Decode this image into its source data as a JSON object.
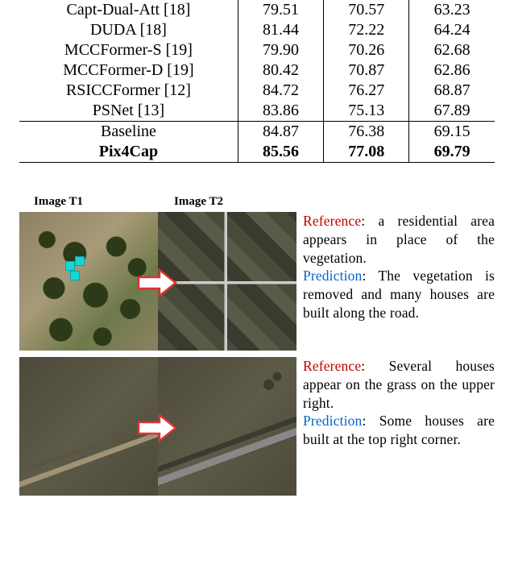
{
  "table": {
    "rows_top": [
      {
        "method": "Capt-Dual-Att [18]",
        "c1": "79.51",
        "c2": "70.57",
        "c3": "63.23"
      },
      {
        "method": "DUDA [18]",
        "c1": "81.44",
        "c2": "72.22",
        "c3": "64.24"
      },
      {
        "method": "MCCFormer-S [19]",
        "c1": "79.90",
        "c2": "70.26",
        "c3": "62.68"
      },
      {
        "method": "MCCFormer-D [19]",
        "c1": "80.42",
        "c2": "70.87",
        "c3": "62.86"
      },
      {
        "method": "RSICCFormer [12]",
        "c1": "84.72",
        "c2": "76.27",
        "c3": "68.87"
      },
      {
        "method": "PSNet [13]",
        "c1": "83.86",
        "c2": "75.13",
        "c3": "67.89"
      }
    ],
    "rows_bottom": [
      {
        "method": "Baseline",
        "c1": "84.87",
        "c2": "76.38",
        "c3": "69.15",
        "bold": false
      },
      {
        "method": "Pix4Cap",
        "c1": "85.56",
        "c2": "77.08",
        "c3": "69.79",
        "bold": true
      }
    ]
  },
  "figure": {
    "label_t1": "Image T1",
    "label_t2": "Image T2",
    "rows": [
      {
        "reference_label": "Reference",
        "reference_text": ": a residential area appears in place of the vegetation.",
        "prediction_label": "Prediction",
        "prediction_text": ": The vegetation is removed and many houses are built along the road."
      },
      {
        "reference_label": "Reference",
        "reference_text": ": Several houses appear on the grass on the upper right.",
        "prediction_label": "Prediction",
        "prediction_text": ": Some houses are built at the top right corner."
      }
    ]
  }
}
